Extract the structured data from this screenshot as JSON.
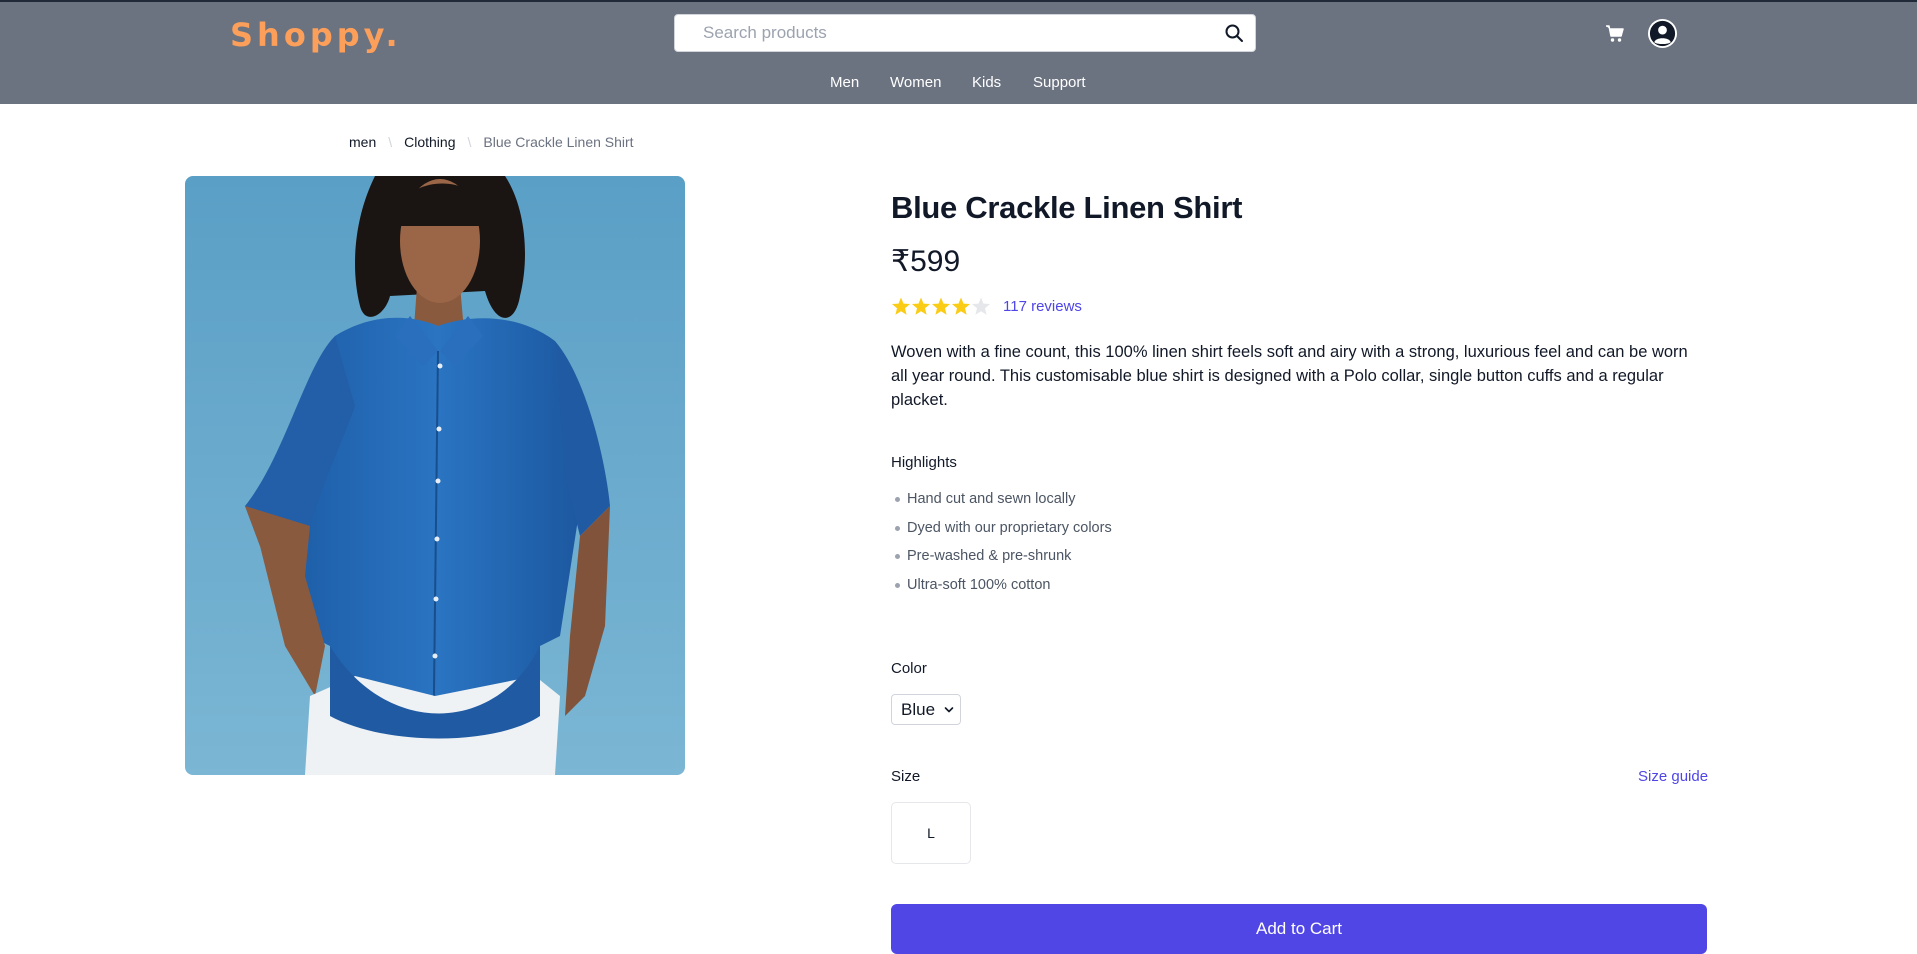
{
  "header": {
    "logo": "Shoppy.",
    "search_placeholder": "Search products",
    "nav": [
      "Men",
      "Women",
      "Kids",
      "Support"
    ]
  },
  "breadcrumb": {
    "items": [
      "men",
      "Clothing"
    ],
    "current": "Blue Crackle Linen Shirt"
  },
  "product": {
    "title": "Blue Crackle Linen Shirt",
    "price": "₹599",
    "rating": 4,
    "rating_max": 5,
    "reviews": "117 reviews",
    "description": "Woven with a fine count, this 100% linen shirt feels soft and airy with a strong, luxurious feel and can be worn all year round. This customisable blue shirt is designed with a Polo collar, single button cuffs and a regular placket.",
    "highlights_title": "Highlights",
    "highlights": [
      "Hand cut and sewn locally",
      "Dyed with our proprietary colors",
      "Pre-washed & pre-shrunk",
      "Ultra-soft 100% cotton"
    ],
    "color_label": "Color",
    "color_selected": "Blue",
    "size_label": "Size",
    "size_guide": "Size guide",
    "sizes": [
      "L"
    ],
    "add_to_cart": "Add to Cart"
  },
  "colors": {
    "header_bg": "#6b7280",
    "logo": "#fb9f5a",
    "accent": "#4f46e5",
    "star": "#facc15",
    "star_empty": "#e5e7eb"
  }
}
